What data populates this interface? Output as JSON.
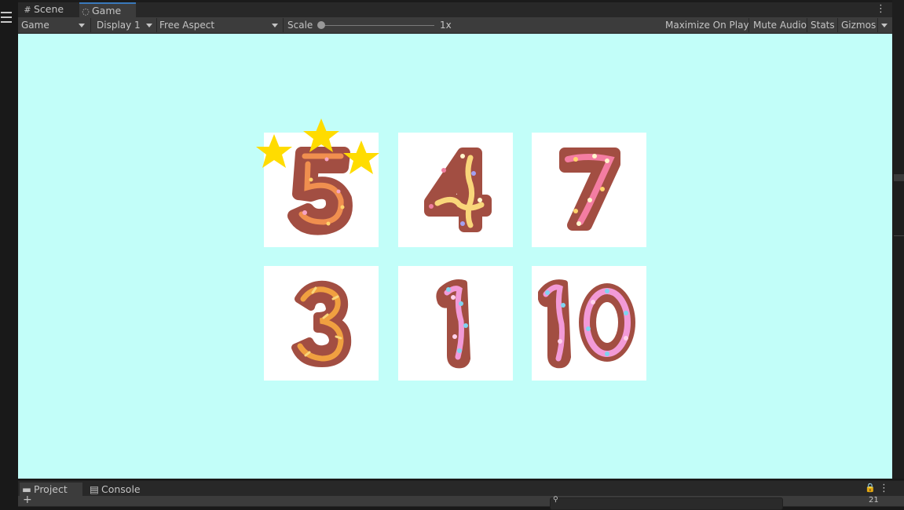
{
  "tabs": [
    {
      "label": "Scene",
      "icon": "grid-icon",
      "active": false
    },
    {
      "label": "Game",
      "icon": "gamepad-icon",
      "active": true
    }
  ],
  "toolbar": {
    "game_mode": "Game",
    "display": "Display 1",
    "aspect": "Free Aspect",
    "scale_label": "Scale",
    "scale_value": "1x",
    "maximize": "Maximize On Play",
    "mute": "Mute Audio",
    "stats": "Stats",
    "gizmos": "Gizmos"
  },
  "viewport": {
    "background": "#c2fef9",
    "cards": [
      {
        "number": "5",
        "icing": "#f08f4f",
        "has_stars": true
      },
      {
        "number": "4",
        "icing": "#f9d67a"
      },
      {
        "number": "7",
        "icing": "#f47da2"
      },
      {
        "number": "3",
        "icing": "#f0a040"
      },
      {
        "number": "1",
        "icing": "#f29ad7"
      },
      {
        "number": "10",
        "icing": "#f29ad7"
      }
    ],
    "star_count": 3,
    "star_color": "#ffdc00"
  },
  "bottom_panel": {
    "tabs": [
      {
        "label": "Project",
        "icon": "folder-icon",
        "active": true
      },
      {
        "label": "Console",
        "icon": "console-icon",
        "active": false
      }
    ],
    "add_button": "+",
    "visible_count": "21"
  }
}
